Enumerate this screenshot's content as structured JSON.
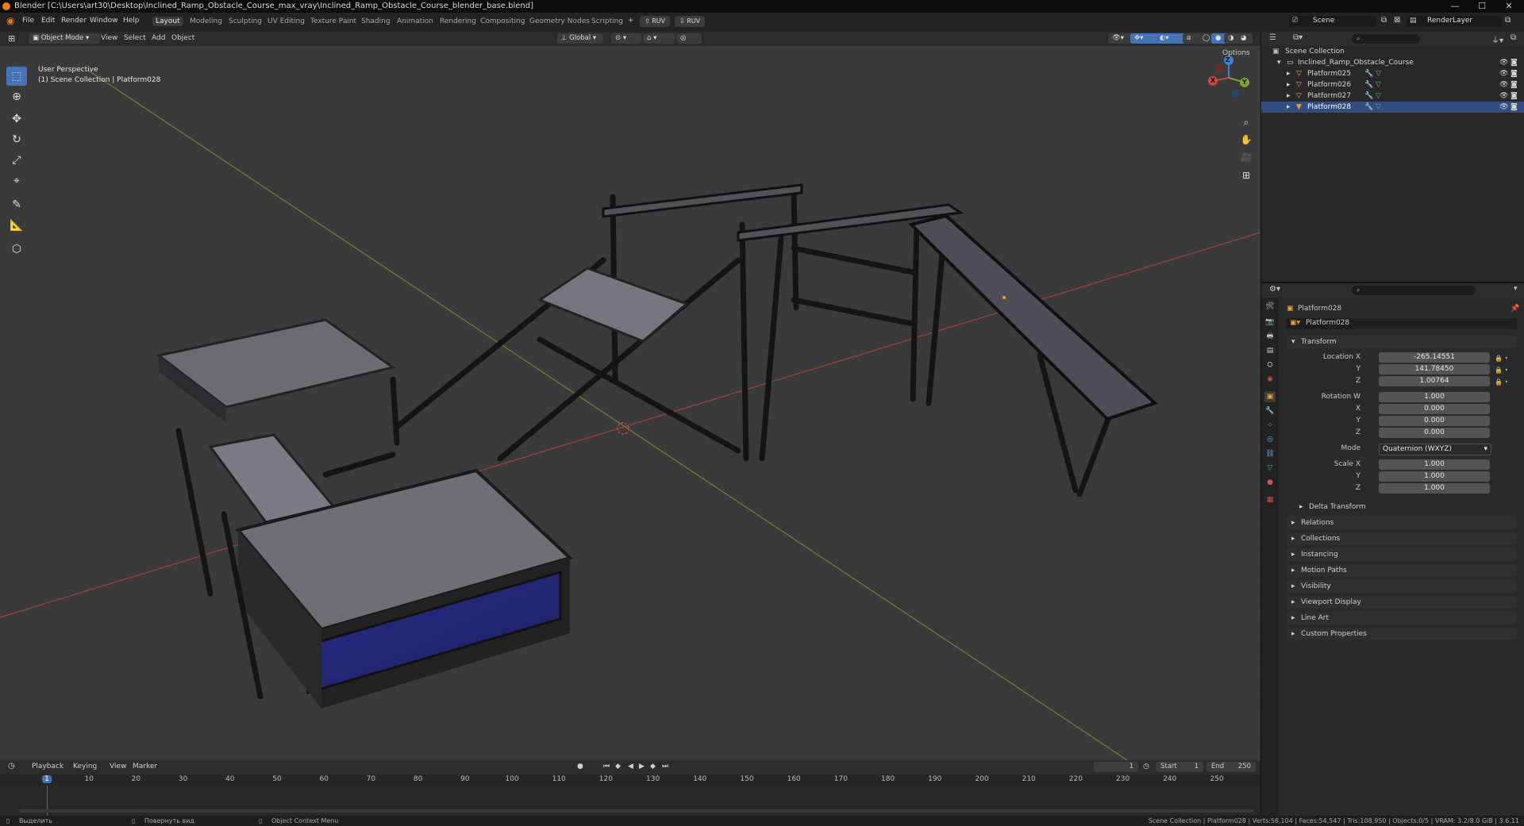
{
  "window": {
    "title": "Blender [C:\\Users\\art30\\Desktop\\Inclined_Ramp_Obstacle_Course_max_vray\\Inclined_Ramp_Obstacle_Course_blender_base.blend]",
    "minimize": "—",
    "maximize": "☐",
    "close": "✕"
  },
  "menu": {
    "file": "File",
    "edit": "Edit",
    "render": "Render",
    "window": "Window",
    "help": "Help"
  },
  "workspaces": [
    "Layout",
    "Modeling",
    "Sculpting",
    "UV Editing",
    "Texture Paint",
    "Shading",
    "Animation",
    "Rendering",
    "Compositing",
    "Geometry Nodes",
    "Scripting"
  ],
  "topbar": {
    "add_tab": "+",
    "ruv_btn_1": "RUV",
    "ruv_btn_2": "RUV",
    "scene": "Scene",
    "render_layer": "RenderLayer"
  },
  "viewport_header": {
    "mode": "Object Mode",
    "view": "View",
    "select": "Select",
    "add": "Add",
    "object": "Object",
    "orientation": "Global",
    "options": "Options"
  },
  "viewport": {
    "perspective": "User Perspective",
    "collection_info": "(1) Scene Collection | Platform028",
    "gizmo_x": "X",
    "gizmo_y": "Y",
    "gizmo_z": "Z"
  },
  "timeline": {
    "playback": "Playback",
    "keying": "Keying",
    "view": "View",
    "marker": "Marker",
    "current_frame": "1",
    "start_label": "Start",
    "start": "1",
    "end_label": "End",
    "end": "250",
    "ticks": [
      "1",
      "10",
      "20",
      "30",
      "40",
      "50",
      "60",
      "70",
      "80",
      "90",
      "100",
      "110",
      "120",
      "130",
      "140",
      "150",
      "160",
      "170",
      "180",
      "190",
      "200",
      "210",
      "220",
      "230",
      "240",
      "250"
    ]
  },
  "statusbar": {
    "left": "Выделить",
    "middle": "Повернуть вид",
    "context": "Object Context Menu",
    "stats": "Scene Collection | Platform028 | Verts:58,104 | Faces:54,547 | Tris:108,950 | Objects:0/5 | VRAM: 3.2/8.0 GiB | 3.6.11"
  },
  "outliner": {
    "scene_collection": "Scene Collection",
    "collection": "Inclined_Ramp_Obstacle_Course",
    "objects": [
      "Platform025",
      "Platform026",
      "Platform027",
      "Platform028"
    ]
  },
  "properties": {
    "object_name": "Platform028",
    "object_datablock": "Platform028",
    "transform_header": "Transform",
    "location_x_label": "Location X",
    "y_label": "Y",
    "z_label": "Z",
    "location_x": "-265.14551",
    "location_y": "141.78450",
    "location_z": "1.00764",
    "rotation_w_label": "Rotation W",
    "x_label": "X",
    "rotation_w": "1.000",
    "rotation_x": "0.000",
    "rotation_y": "0.000",
    "rotation_z": "0.000",
    "mode_label": "Mode",
    "mode_value": "Quaternion (WXYZ)",
    "scale_x_label": "Scale X",
    "scale_x": "1.000",
    "scale_y": "1.000",
    "scale_z": "1.000",
    "delta_transform": "Delta Transform",
    "sections": [
      "Relations",
      "Collections",
      "Instancing",
      "Motion Paths",
      "Visibility",
      "Viewport Display",
      "Line Art",
      "Custom Properties"
    ]
  },
  "colors": {
    "accent": "#4772b3",
    "x_axis": "#c94545",
    "y_axis": "#7fa32a",
    "z_axis": "#3c80d6",
    "origin": "#f0a030"
  }
}
